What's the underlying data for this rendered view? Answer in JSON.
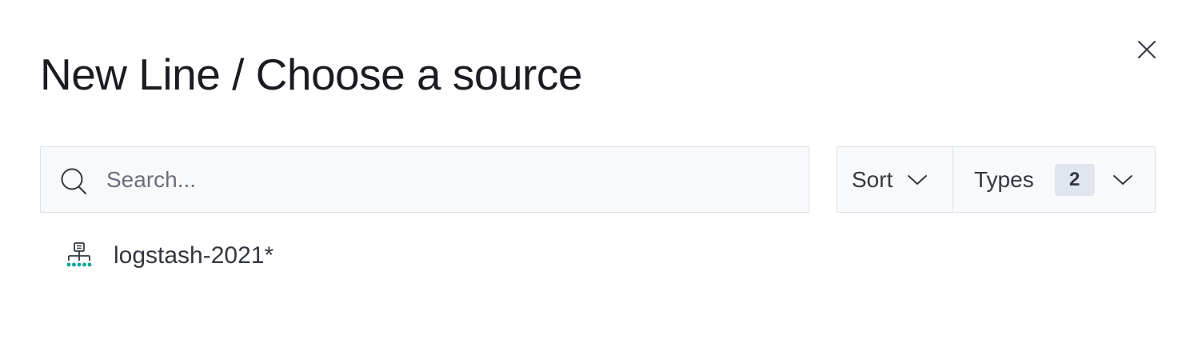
{
  "modal": {
    "title": "New Line / Choose a source",
    "close_icon": "close-icon"
  },
  "search": {
    "placeholder": "Search...",
    "value": "",
    "icon": "search-icon"
  },
  "filters": {
    "sort_label": "Sort",
    "types_label": "Types",
    "types_count": "2",
    "chevron_icon": "chevron-down-icon"
  },
  "results": [
    {
      "label": "logstash-2021*",
      "icon": "index-pattern-icon",
      "icon_color": "#00a69b"
    }
  ],
  "colors": {
    "text_primary": "#1a1c21",
    "text_secondary": "#343741",
    "placeholder": "#69707d",
    "field_background": "#f9fafc",
    "border": "#dde1e8",
    "badge_background": "#e0e5ee",
    "accent_teal": "#00a69b"
  }
}
